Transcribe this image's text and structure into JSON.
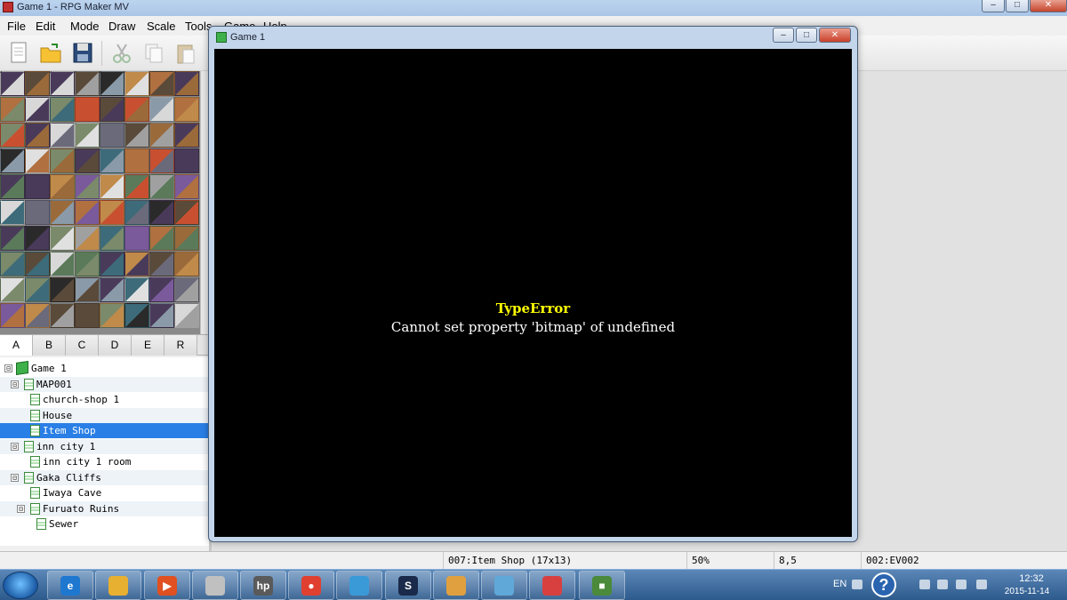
{
  "app": {
    "title": "Game 1 - RPG Maker MV",
    "menu": [
      "File",
      "Edit",
      "Mode",
      "Draw",
      "Scale",
      "Tools",
      "Game",
      "Help"
    ]
  },
  "toolbar": {
    "icons": [
      "new-project-icon",
      "open-project-icon",
      "save-project-icon",
      "cut-icon",
      "copy-icon",
      "paste-icon"
    ]
  },
  "tileset_tabs": [
    "A",
    "B",
    "C",
    "D",
    "E",
    "R"
  ],
  "tileset_active_tab": "A",
  "map_tree": [
    {
      "label": "Game 1",
      "kind": "game",
      "expander": "⊟"
    },
    {
      "label": "MAP001",
      "kind": "map",
      "expander": "⊟"
    },
    {
      "label": "church-shop 1",
      "kind": "map",
      "expander": ""
    },
    {
      "label": "House",
      "kind": "map",
      "expander": ""
    },
    {
      "label": "Item Shop",
      "kind": "map",
      "expander": "",
      "selected": true
    },
    {
      "label": "inn city 1",
      "kind": "map",
      "expander": "⊟"
    },
    {
      "label": "inn city 1 room",
      "kind": "map",
      "expander": ""
    },
    {
      "label": "Gaka Cliffs",
      "kind": "map",
      "expander": "⊟"
    },
    {
      "label": "Iwaya Cave",
      "kind": "map",
      "expander": ""
    },
    {
      "label": "Furuato Ruins",
      "kind": "map",
      "expander": "⊟"
    },
    {
      "label": "Sewer",
      "kind": "map",
      "expander": ""
    }
  ],
  "statusbar": {
    "map": "007:Item Shop (17x13)",
    "zoom": "50%",
    "coords": "8,5",
    "event": "002:EV002"
  },
  "game_window": {
    "title": "Game 1",
    "error_title": "TypeError",
    "error_message": "Cannot set property 'bitmap' of undefined"
  },
  "taskbar": {
    "apps": [
      "internet-explorer-icon",
      "file-explorer-icon",
      "media-player-icon",
      "app-icon",
      "hp-icon",
      "chrome-icon",
      "people-icon",
      "steam-icon",
      "paint-icon",
      "notes-icon",
      "rpg-maker-icon",
      "game-icon"
    ],
    "language": "EN",
    "clock_time": "12:32",
    "clock_date": "2015-11-14"
  },
  "colors": {
    "error_title": "#ffff00",
    "selection": "#2a7fe6"
  }
}
